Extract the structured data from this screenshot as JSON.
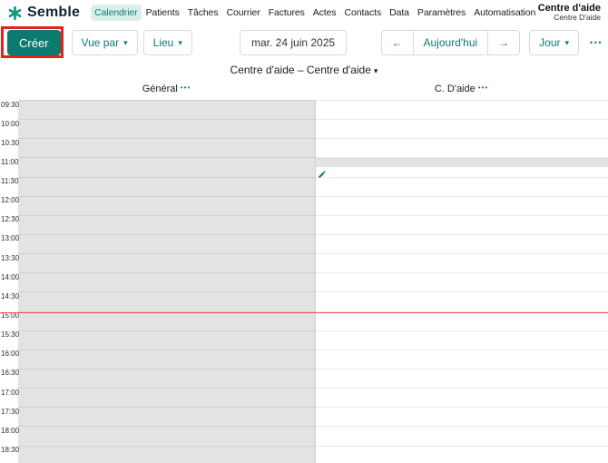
{
  "brand": {
    "name": "Semble"
  },
  "nav": {
    "active": "Calendrier",
    "items": [
      "Calendrier",
      "Patients",
      "Tâches",
      "Courrier",
      "Factures",
      "Actes",
      "Contacts",
      "Data",
      "Paramètres",
      "Automatisation"
    ]
  },
  "account": {
    "name": "Centre d'aide",
    "subname": "Centre D'aide"
  },
  "toolbar": {
    "create": "Créer",
    "view_by": "Vue par",
    "location": "Lieu",
    "date": "mar. 24 juin 2025",
    "today": "Aujourd'hui",
    "view_mode": "Jour"
  },
  "icons": {
    "caret_down": "▾",
    "arrow_left": "←",
    "arrow_right": "→",
    "more_dots": "•••"
  },
  "subheader": {
    "title": "Centre d'aide – Centre d'aide"
  },
  "calendar": {
    "columns": [
      {
        "label": "Général"
      },
      {
        "label": "C. D'aide"
      }
    ],
    "times": [
      "09:30",
      "10:00",
      "10:30",
      "11:00",
      "11:30",
      "12:00",
      "12:30",
      "13:00",
      "13:30",
      "14:00",
      "14:30",
      "15:00",
      "15:30",
      "16:00",
      "16:30",
      "17:00",
      "17:30",
      "18:00",
      "18:30"
    ]
  },
  "colors": {
    "teal": "#0e7b6f",
    "teal_light_bg": "#d9efec",
    "annotation_red": "#e0241c",
    "current_time_red": "#f0544c",
    "unavailable_gray": "#e3e3e3"
  }
}
